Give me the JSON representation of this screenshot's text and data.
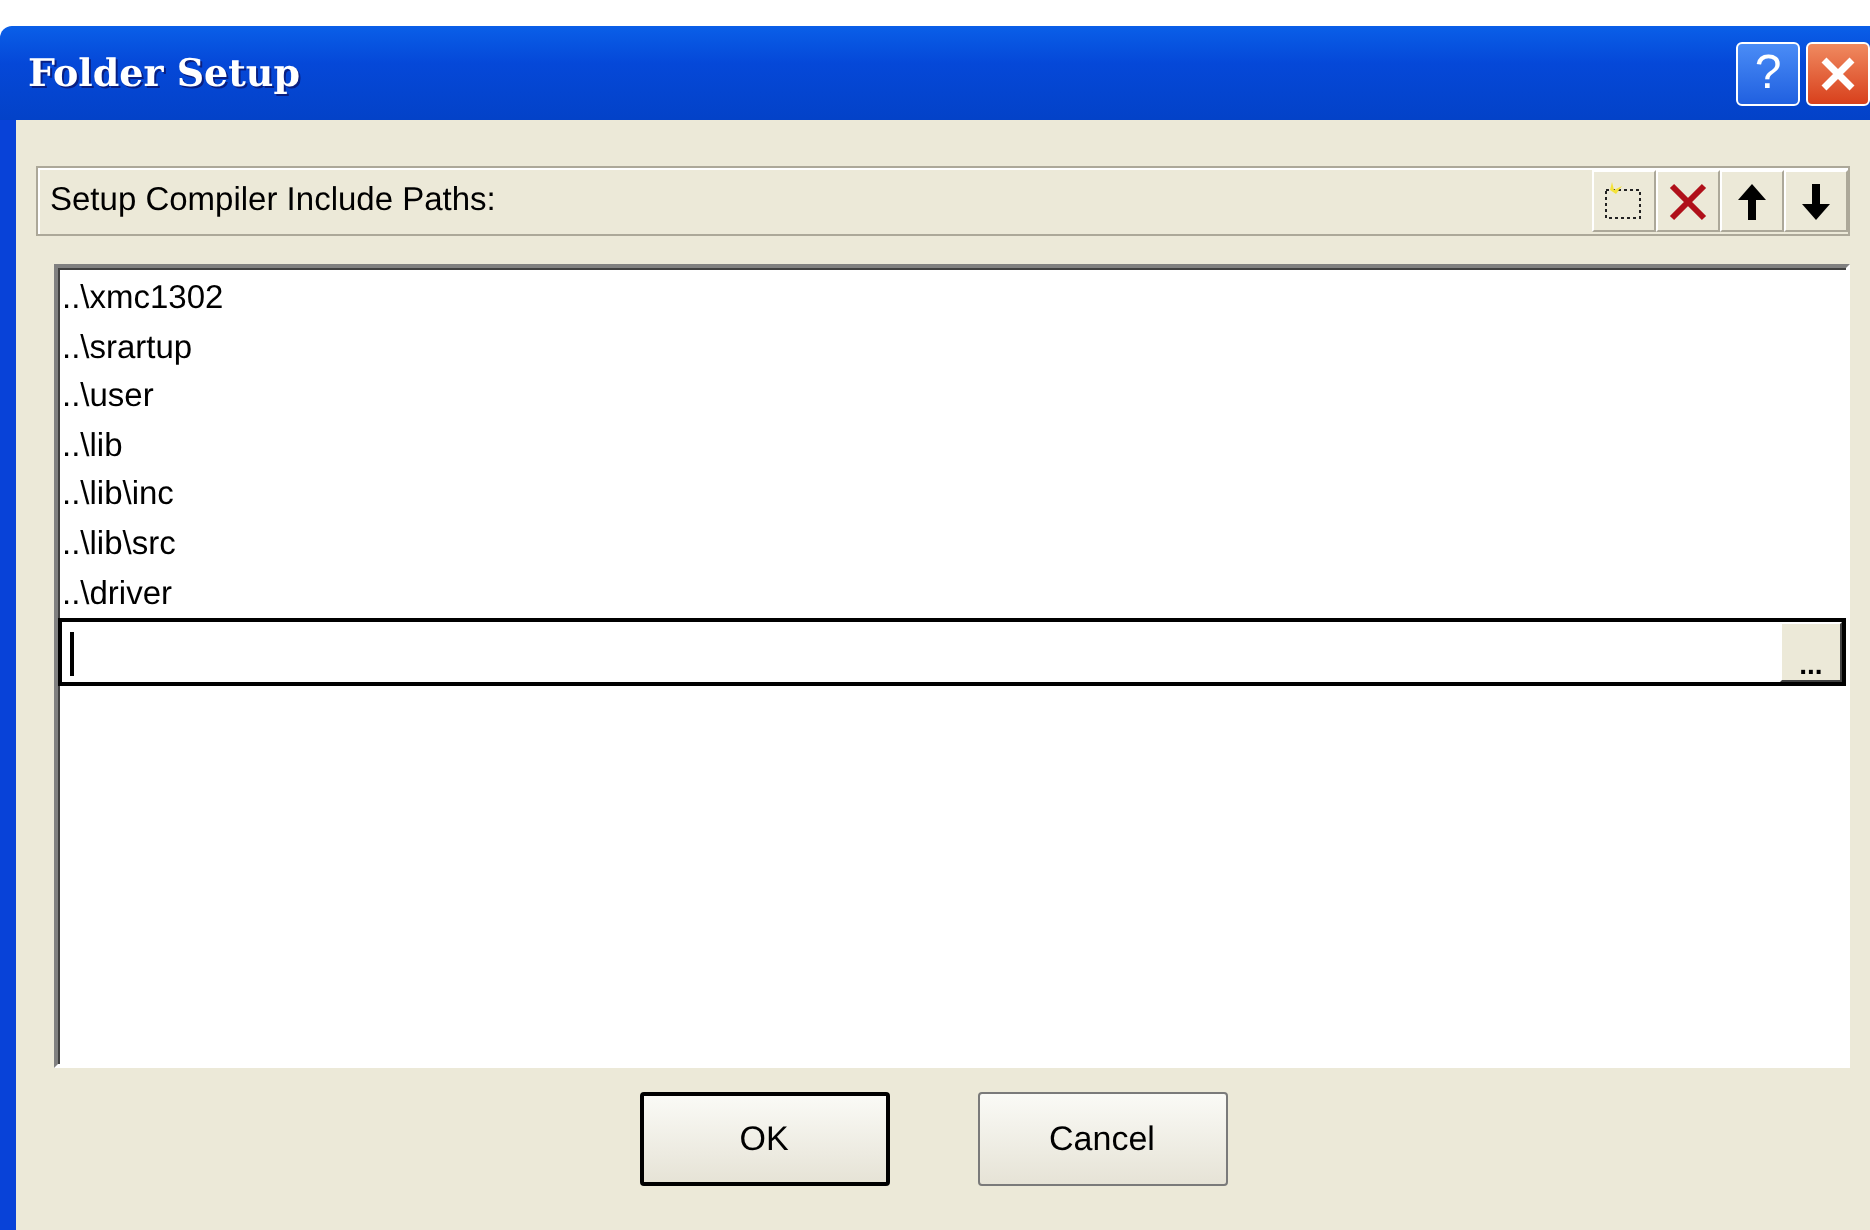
{
  "window": {
    "title": "Folder Setup"
  },
  "title_buttons": [
    {
      "kind": "help",
      "label": "?"
    },
    {
      "kind": "close"
    }
  ],
  "header": {
    "label": "Setup Compiler Include Paths:"
  },
  "toolbar": [
    {
      "kind": "new"
    },
    {
      "kind": "delete"
    },
    {
      "kind": "up"
    },
    {
      "kind": "down"
    }
  ],
  "paths": [
    "..\\xmc1302",
    "..\\srartup",
    "..\\user",
    "..\\lib",
    "..\\lib\\inc",
    "..\\lib\\src",
    "..\\driver"
  ],
  "edit_row": {
    "browse_label": "..."
  },
  "buttons": [
    {
      "label": "OK",
      "default": true
    },
    {
      "label": "Cancel",
      "default": false
    }
  ]
}
